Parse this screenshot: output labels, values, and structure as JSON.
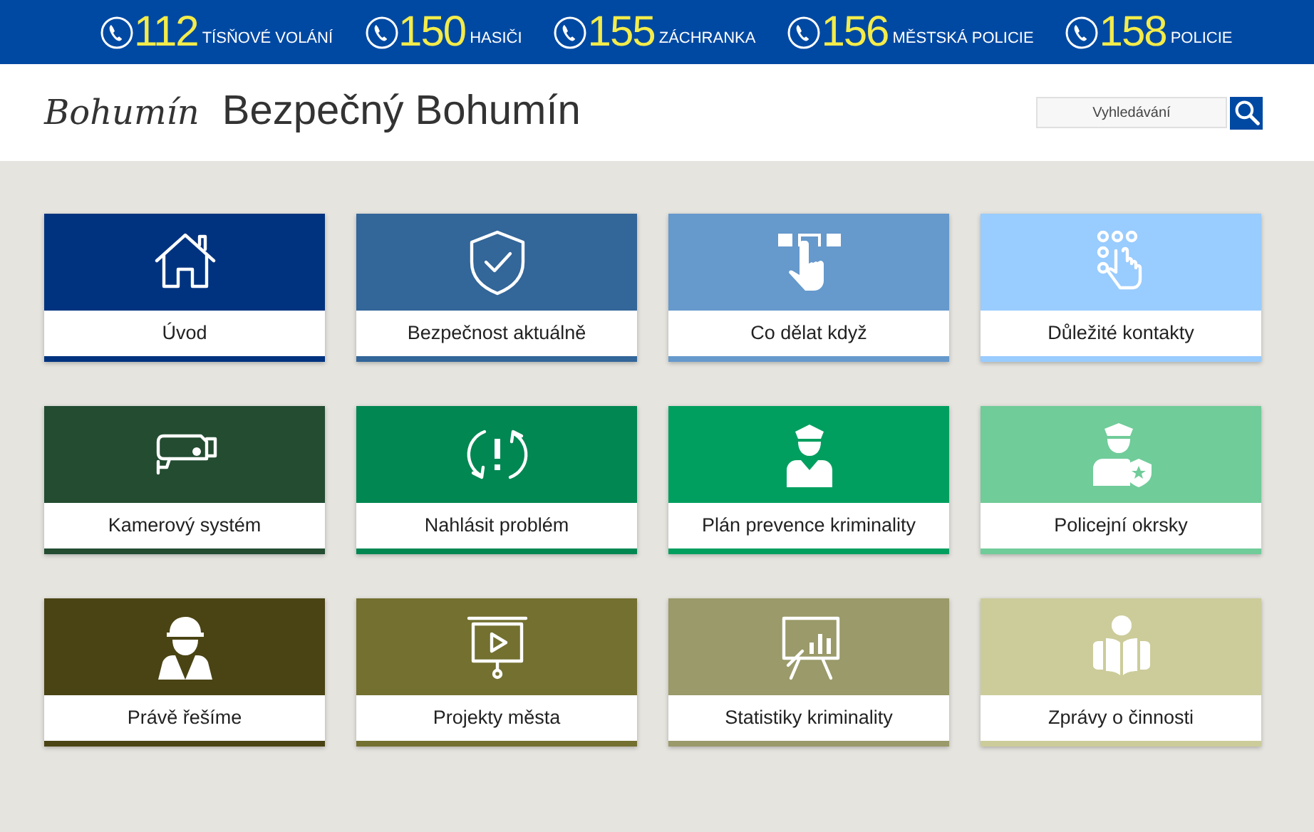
{
  "emergency_bar": [
    {
      "number": "112",
      "label": "TÍSŇOVÉ VOLÁNÍ"
    },
    {
      "number": "150",
      "label": "HASIČI"
    },
    {
      "number": "155",
      "label": "ZÁCHRANKA"
    },
    {
      "number": "156",
      "label": "MĚSTSKÁ POLICIE"
    },
    {
      "number": "158",
      "label": "POLICIE"
    }
  ],
  "header": {
    "logo": "Bohumín",
    "title": "Bezpečný Bohumín",
    "search": {
      "placeholder": "Vyhledávání"
    }
  },
  "tiles": [
    {
      "label": "Úvod",
      "color": "#00337f"
    },
    {
      "label": "Bezpečnost aktuálně",
      "color": "#336699"
    },
    {
      "label": "Co dělat když",
      "color": "#6699cc"
    },
    {
      "label": "Důležité kontakty",
      "color": "#99ccff"
    },
    {
      "label": "Kamerový systém",
      "color": "#234c31"
    },
    {
      "label": "Nahlásit problém",
      "color": "#008752"
    },
    {
      "label": "Plán prevence kriminality",
      "color": "#009f5f"
    },
    {
      "label": "Policejní okrsky",
      "color": "#70cc99"
    },
    {
      "label": "Právě řešíme",
      "color": "#4a4414"
    },
    {
      "label": "Projekty města",
      "color": "#737030"
    },
    {
      "label": "Statistiky kriminality",
      "color": "#9a9a6a"
    },
    {
      "label": "Zprávy o činnosti",
      "color": "#cccc9b"
    }
  ]
}
